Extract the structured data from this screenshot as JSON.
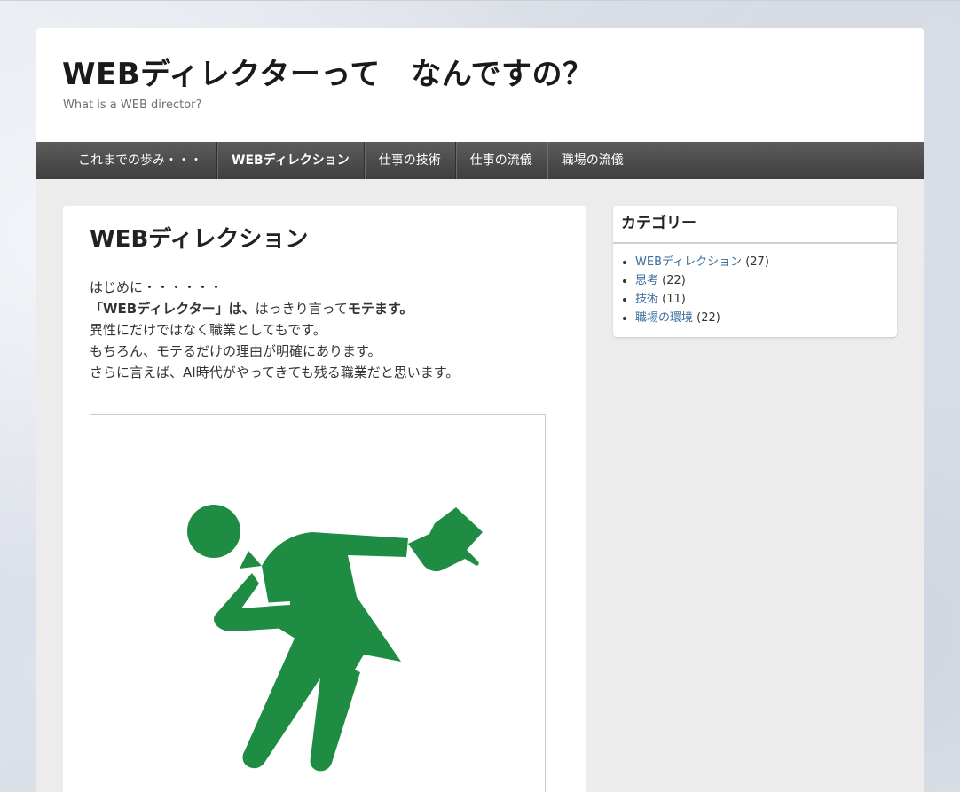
{
  "site": {
    "title": "WEBディレクターって　なんですの？",
    "description": "What is a WEB director?"
  },
  "nav": {
    "items": [
      {
        "label": "これまでの歩み・・・",
        "active": false
      },
      {
        "label": "WEBディレクション",
        "active": true
      },
      {
        "label": "仕事の技術",
        "active": false
      },
      {
        "label": "仕事の流儀",
        "active": false
      },
      {
        "label": "職場の流儀",
        "active": false
      }
    ]
  },
  "article": {
    "title": "WEBディレクション",
    "intro": "はじめに・・・・・・",
    "line2_bold1": "「WEBディレクター」は、",
    "line2_mid": "はっきり言って",
    "line2_bold2": "モテます。",
    "line3": "異性にだけではなく職業としてもです。",
    "line4": "もちろん、モテるだけの理由が明確にあります。",
    "line5": "さらに言えば、AI時代がやってきても残る職業だと思います。"
  },
  "illustration": {
    "icon": "bowing-gentleman-with-top-hat-icon",
    "color": "#1e8c43"
  },
  "sidebar": {
    "widget_title": "カテゴリー",
    "categories": [
      {
        "name": "WEBディレクション",
        "count": "(27)"
      },
      {
        "name": "思考",
        "count": "(22)"
      },
      {
        "name": "技術",
        "count": "(11)"
      },
      {
        "name": "職場の環境",
        "count": "(22)"
      }
    ]
  },
  "colors": {
    "nav_bg": "#4a4a4a",
    "link": "#3a6f9f",
    "page_bg": "#ececec"
  }
}
